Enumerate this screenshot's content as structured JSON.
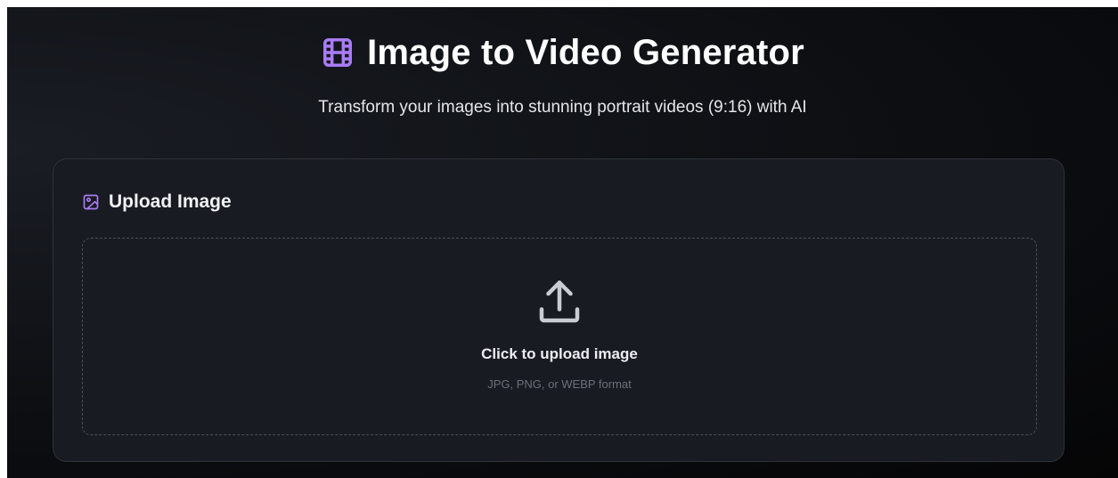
{
  "header": {
    "icon": "film-icon",
    "title": "Image to Video Generator",
    "subtitle": "Transform your images into stunning portrait videos (9:16) with AI"
  },
  "upload_card": {
    "icon": "image-icon",
    "heading": "Upload Image",
    "dropzone": {
      "icon": "upload-icon",
      "label": "Click to upload image",
      "hint": "JPG, PNG, or WEBP format"
    }
  },
  "colors": {
    "accent": "#a97cf5",
    "background": "#0d0f13",
    "card": "#181b21",
    "border": "#2e323a"
  }
}
